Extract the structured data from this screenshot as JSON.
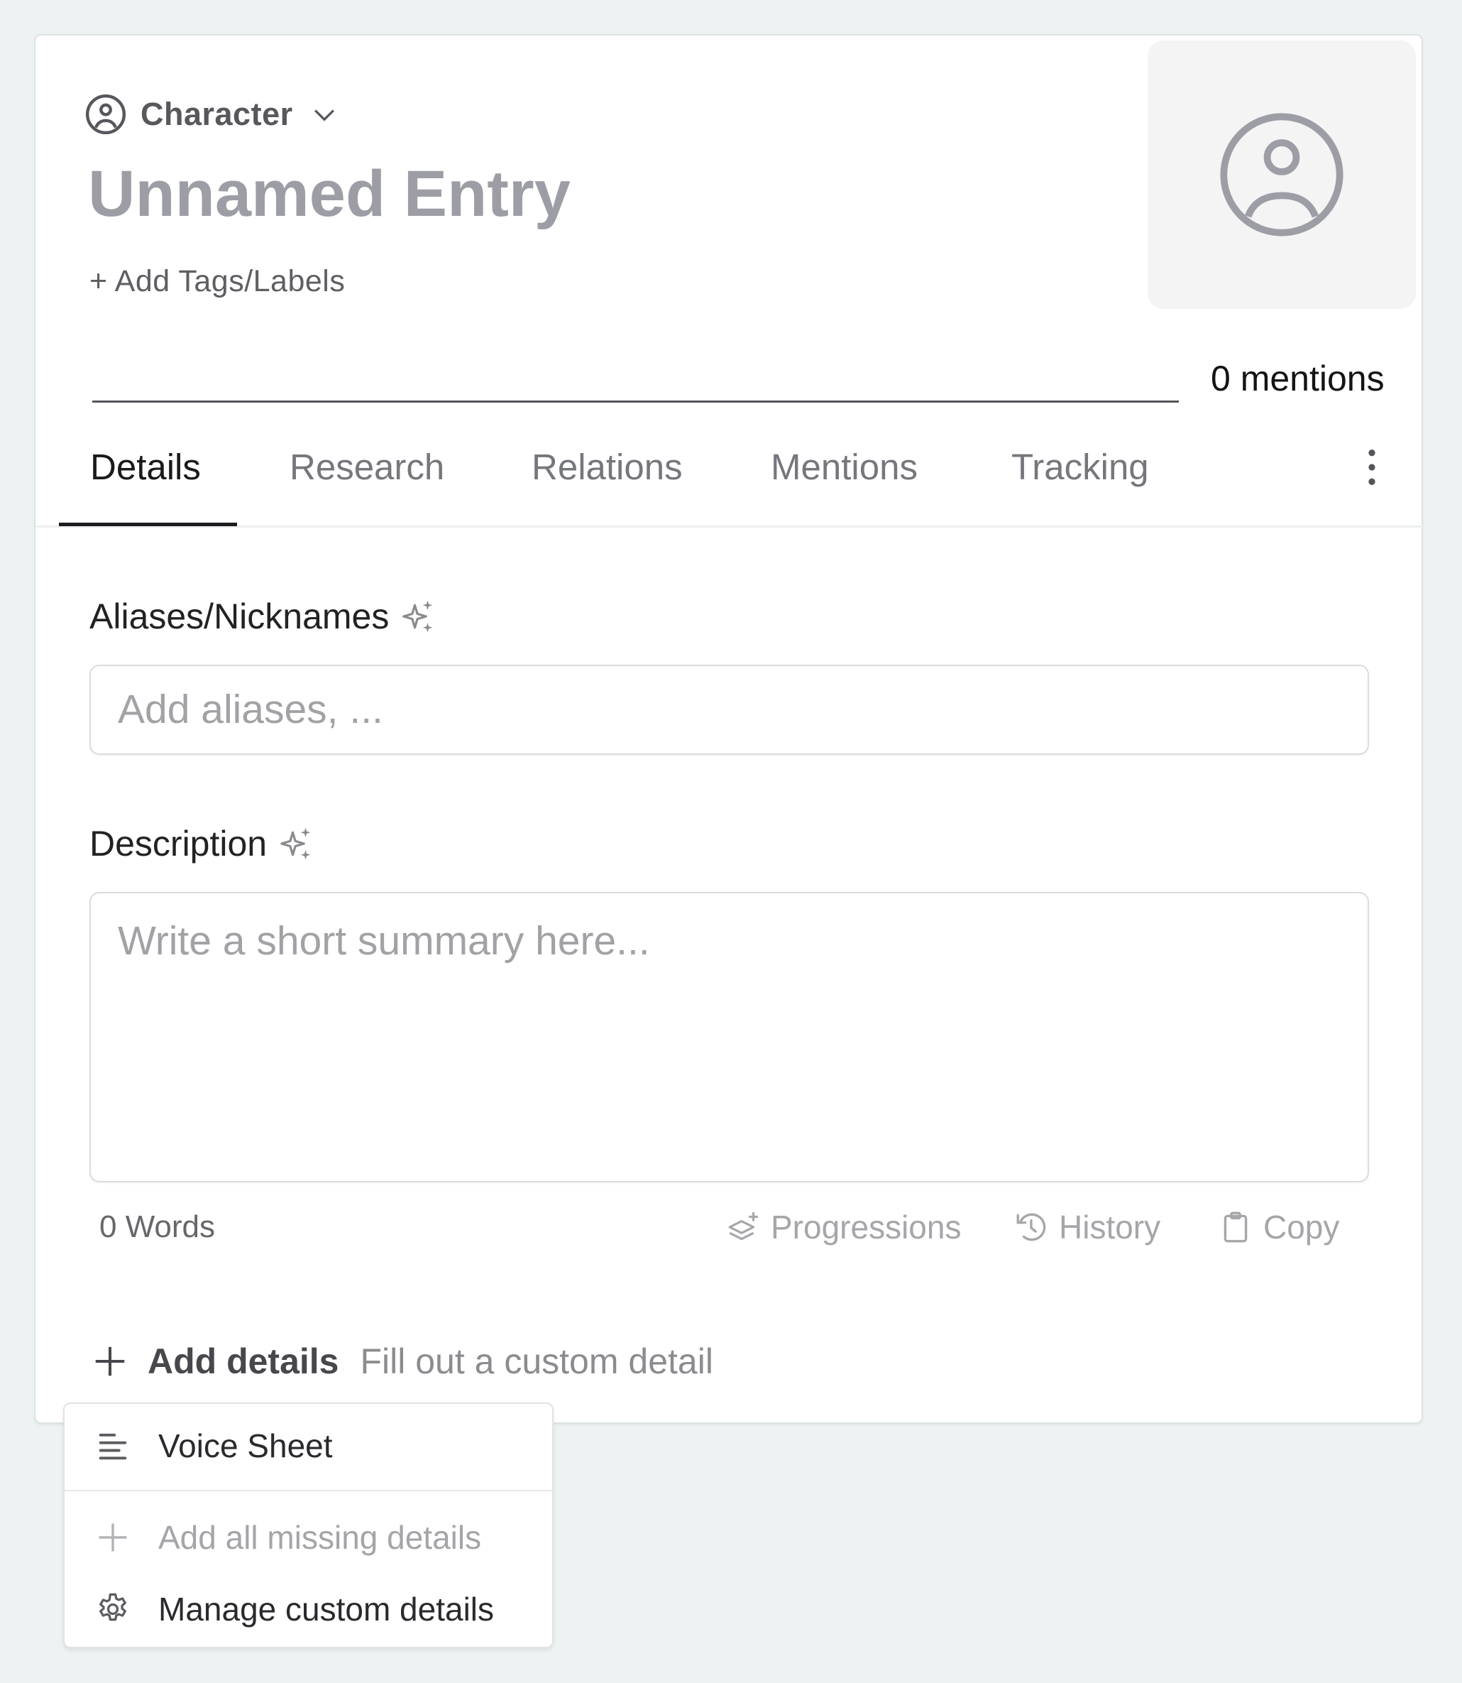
{
  "entry": {
    "type_label": "Character",
    "type_icon": "user-circle-icon",
    "title": "Unnamed Entry",
    "add_tags_label": "+ Add Tags/Labels",
    "avatar_icon": "user-circle-icon",
    "name_input_value": "",
    "mentions_count": "0 mentions"
  },
  "tabs": [
    {
      "label": "Details",
      "active": true
    },
    {
      "label": "Research",
      "active": false
    },
    {
      "label": "Relations",
      "active": false
    },
    {
      "label": "Mentions",
      "active": false
    },
    {
      "label": "Tracking",
      "active": false
    }
  ],
  "more_menu_icon": "kebab-vertical-icon",
  "fields": {
    "aliases": {
      "label": "Aliases/Nicknames",
      "ai_icon": "sparkles-icon",
      "placeholder": "Add aliases, ...",
      "value": ""
    },
    "description": {
      "label": "Description",
      "ai_icon": "sparkles-icon",
      "placeholder": "Write a short summary here...",
      "value": "",
      "word_count": "0 Words",
      "actions": [
        {
          "label": "Progressions",
          "icon": "layers-plus-icon"
        },
        {
          "label": "History",
          "icon": "history-icon"
        },
        {
          "label": "Copy",
          "icon": "clipboard-icon"
        }
      ]
    }
  },
  "add_details": {
    "label": "Add details",
    "hint": "Fill out a custom detail",
    "icon": "plus-icon"
  },
  "dropdown": {
    "items": [
      {
        "label": "Voice Sheet",
        "icon": "text-align-left-icon",
        "disabled": false
      },
      {
        "label": "Add all missing details",
        "icon": "plus-icon",
        "disabled": true
      },
      {
        "label": "Manage custom details",
        "icon": "gear-icon",
        "disabled": false
      }
    ]
  },
  "colors": {
    "background": "#edf2f2",
    "card": "#ffffff",
    "title_placeholder": "#9d9ea5",
    "active_tab": "#1a1a1a",
    "inactive_tab": "#76777c",
    "avatar_bg": "#f4f4f5"
  }
}
